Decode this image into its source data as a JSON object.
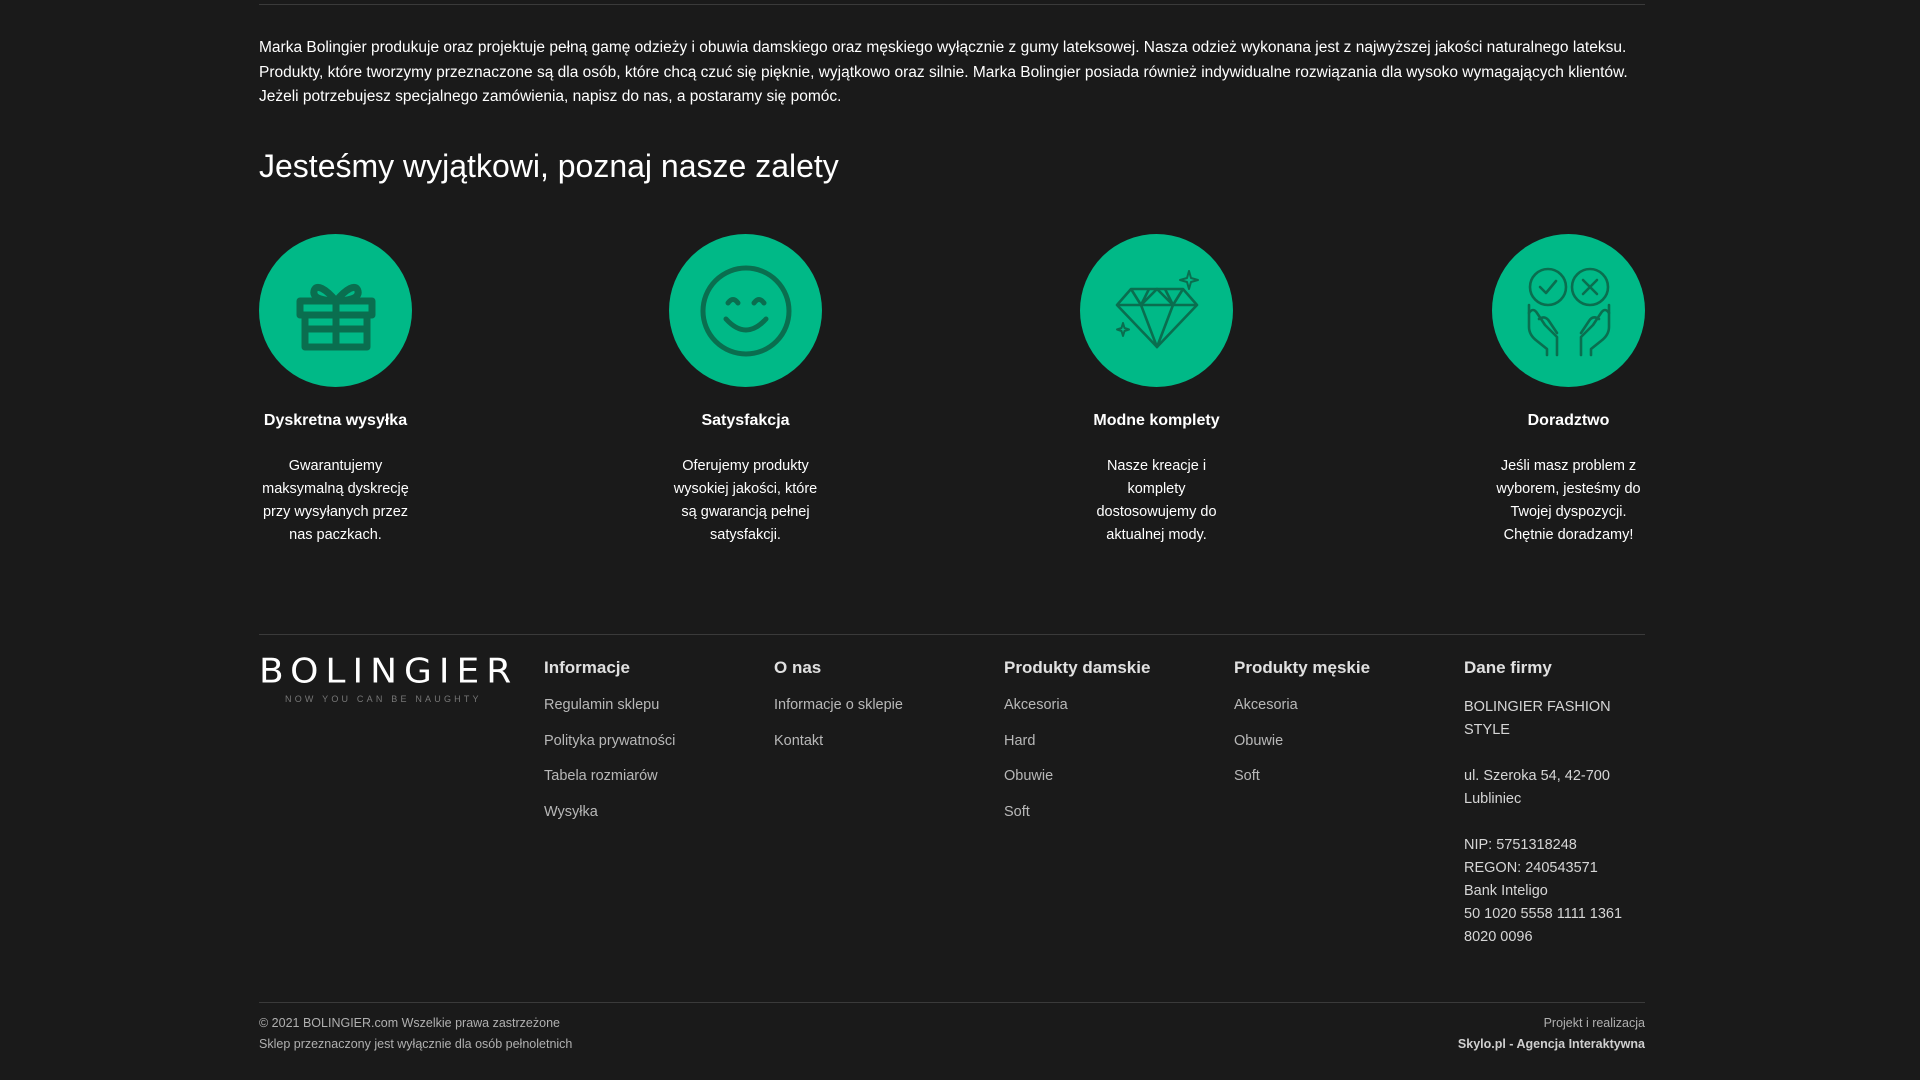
{
  "intro": {
    "text": "Marka Bolingier produkuje oraz projektuje pełną gamę odzieży i obuwia damskiego oraz męskiego wyłącznie z gumy lateksowej.  Nasza odzież wykonana jest z najwyższej jakości naturalnego lateksu. Produkty, które tworzymy przeznaczone są dla osób, które chcą czuć się pięknie, wyjątkowo oraz silnie. Marka Bolingier posiada również indywidualne rozwiązania dla wysoko wymagających klientów. Jeżeli potrzebujesz specjalnego zamówienia, napisz do nas, a postaramy się pomóc."
  },
  "features": {
    "heading": "Jesteśmy wyjątkowi, poznaj nasze zalety",
    "accent": "#00b987",
    "icon_color": "#0a6e4f",
    "items": [
      {
        "icon": "gift-icon",
        "title": "Dyskretna wysyłka",
        "desc": "Gwarantujemy maksymalną dyskrecję przy wysyłanych przez nas paczkach."
      },
      {
        "icon": "smiley-icon",
        "title": "Satysfakcja",
        "desc": "Oferujemy produkty wysokiej jakości, które są gwarancją pełnej satysfakcji."
      },
      {
        "icon": "diamond-icon",
        "title": "Modne komplety",
        "desc": "Nasze kreacje i komplety dostosowujemy do aktualnej mody."
      },
      {
        "icon": "advice-hands-icon",
        "title": "Doradztwo",
        "desc": "Jeśli masz problem z wyborem, jesteśmy do Twojej dyspozycji. Chętnie doradzamy!"
      }
    ]
  },
  "footer": {
    "logo": {
      "main": "BOLINGIER",
      "tagline": "NOW YOU CAN BE NAUGHTY"
    },
    "columns": {
      "informacje": {
        "title": "Informacje",
        "links": [
          "Regulamin sklepu",
          "Polityka prywatności",
          "Tabela rozmiarów",
          "Wysyłka"
        ]
      },
      "o_nas": {
        "title": "O nas",
        "links": [
          "Informacje o sklepie",
          "Kontakt"
        ]
      },
      "damskie": {
        "title": "Produkty damskie",
        "links": [
          "Akcesoria",
          "Hard",
          "Obuwie",
          "Soft"
        ]
      },
      "meskie": {
        "title": "Produkty męskie",
        "links": [
          "Akcesoria",
          "Obuwie",
          "Soft"
        ]
      },
      "firma": {
        "title": "Dane firmy",
        "name": "BOLINGIER FASHION STYLE",
        "address_line1": "ul. Szeroka 54, 42-700",
        "address_line2": "Lubliniec",
        "nip": "NIP: 5751318248",
        "regon": "REGON: 240543571",
        "bank": "Bank Inteligo",
        "account": "50 1020 5558 1111 1361 8020 0096"
      }
    },
    "copyright": "© 2021 BOLINGIER.com Wszelkie prawa zastrzeżone",
    "adult_notice": "Sklep przeznaczony jest wyłącznie dla osób pełnoletnich",
    "credits_label": "Projekt i realizacja",
    "credits_agency": "Skylo.pl - Agencja Interaktywna"
  }
}
